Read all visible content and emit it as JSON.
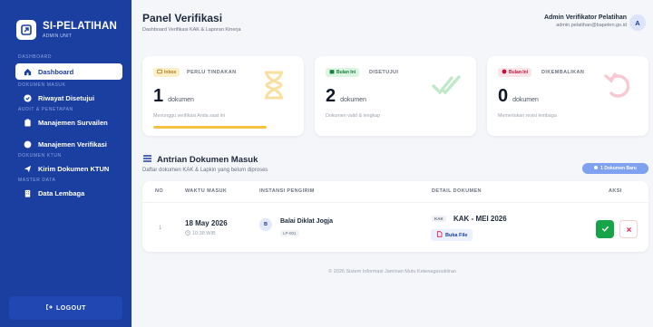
{
  "brand": {
    "name": "SI-PELATIHAN",
    "sub": "ADMIN UNIT"
  },
  "sidebar": {
    "sections": [
      "DASHBOARD",
      "DOKUMEN MASUK",
      "AUDIT & PENETAPAN",
      "DOKUMEN KTUN",
      "MASTER DATA"
    ],
    "items": [
      {
        "label": "Dashboard",
        "icon": "home-icon"
      },
      {
        "label": "Riwayat Disetujui",
        "icon": "check-circle-icon"
      },
      {
        "label": "Manajemen Survailen",
        "icon": "clipboard-icon"
      },
      {
        "label": "Manajemen Verifikasi",
        "icon": "check-badge-icon"
      },
      {
        "label": "Kirim Dokumen KTUN",
        "icon": "send-icon"
      },
      {
        "label": "Data Lembaga",
        "icon": "building-icon"
      }
    ],
    "logout": "LOGOUT"
  },
  "header": {
    "title": "Panel Verifikasi",
    "subtitle": "Dashboard Verifikasi KAK & Laporan Kinerja",
    "user_name": "Admin Verifikator Pelatihan",
    "user_email": "admin.pelatihan@bapeten.go.id",
    "avatar": "A"
  },
  "cards": [
    {
      "badge": "Inbox",
      "title": "PERLU TINDAKAN",
      "count": "1",
      "unit": "dokumen",
      "desc": "Menunggu verifikasi Anda saat ini",
      "color": "#f5c242"
    },
    {
      "badge": "Bulan Ini",
      "title": "DISETUJUI",
      "count": "2",
      "unit": "dokumen",
      "desc": "Dokumen valid & lengkap",
      "color": "#16a34a"
    },
    {
      "badge": "Bulan Ini",
      "title": "DIKEMBALIKAN",
      "count": "0",
      "unit": "dokumen",
      "desc": "Memerlukan revisi lembaga",
      "color": "#e11d48"
    }
  ],
  "queue": {
    "title": "Antrian Dokumen Masuk",
    "subtitle": "Daftar dokumen KAK & Lapkin yang belum diproses",
    "badge": "1 Dokumen Baru",
    "columns": [
      "NO",
      "WAKTU MASUK",
      "INSTANSI PENGIRIM",
      "DETAIL DOKUMEN",
      "AKSI"
    ],
    "rows": [
      {
        "no": "1",
        "date": "18 May 2026",
        "time": "10:38 WIB",
        "inst_initial": "B",
        "inst_name": "Balai Diklat Jogja",
        "inst_code": "LP-001",
        "doc_tag": "KAK",
        "doc_title": "KAK - MEI 2026",
        "doc_button": "Buka File"
      }
    ]
  },
  "footer": "© 2026 Sistem Informasi Jaminan Mutu Ketenaganukliran"
}
